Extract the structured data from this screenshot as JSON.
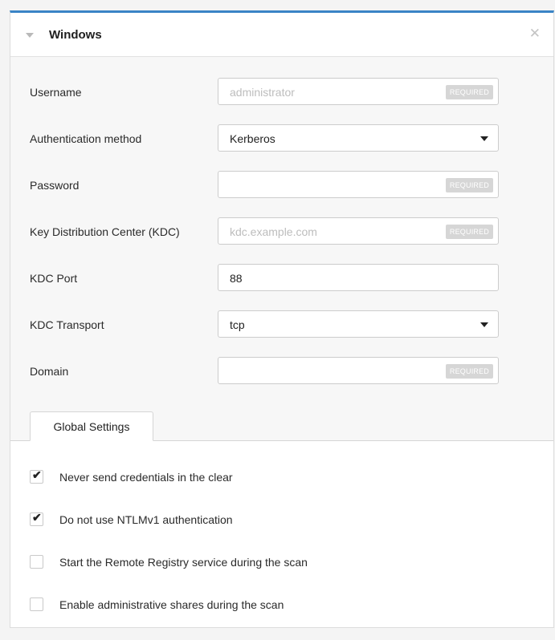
{
  "panel": {
    "title": "Windows",
    "close_glyph": "✕"
  },
  "fields": [
    {
      "label": "Username",
      "value": "",
      "placeholder": "administrator",
      "required_badge": "REQUIRED",
      "kind": "text"
    },
    {
      "label": "Authentication method",
      "value": "Kerberos",
      "kind": "select"
    },
    {
      "label": "Password",
      "value": "",
      "placeholder": "",
      "required_badge": "REQUIRED",
      "kind": "password"
    },
    {
      "label": "Key Distribution Center (KDC)",
      "value": "",
      "placeholder": "kdc.example.com",
      "required_badge": "REQUIRED",
      "kind": "text"
    },
    {
      "label": "KDC Port",
      "value": "88",
      "kind": "text"
    },
    {
      "label": "KDC Transport",
      "value": "tcp",
      "kind": "select"
    },
    {
      "label": "Domain",
      "value": "",
      "placeholder": "",
      "required_badge": "REQUIRED",
      "kind": "text"
    }
  ],
  "tabs": {
    "global_settings": "Global Settings"
  },
  "settings": [
    {
      "label": "Never send credentials in the clear",
      "checked": true
    },
    {
      "label": "Do not use NTLMv1 authentication",
      "checked": true
    },
    {
      "label": "Start the Remote Registry service during the scan",
      "checked": false
    },
    {
      "label": "Enable administrative shares during the scan",
      "checked": false
    }
  ],
  "icons": {
    "collapse": "caret-down-icon",
    "close": "close-icon",
    "select": "chevron-down-icon",
    "check": "checkmark-icon"
  },
  "colors": {
    "accent": "#3a84c6",
    "required_badge_bg": "#d6d6d6",
    "body_bg": "#f7f7f7"
  }
}
